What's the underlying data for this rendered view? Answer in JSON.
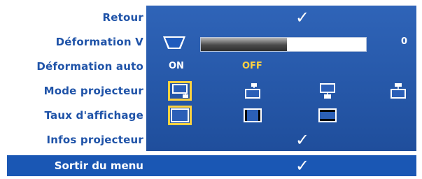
{
  "menu": {
    "rows": [
      {
        "label": "Retour"
      },
      {
        "label": "Déformation V"
      },
      {
        "label": "Déformation auto"
      },
      {
        "label": "Mode projecteur"
      },
      {
        "label": "Taux d'affichage"
      },
      {
        "label": "Infos projecteur"
      }
    ],
    "checkmark": "✓",
    "keystone": {
      "value": "0",
      "fill_percent": 52
    },
    "auto_keystone": {
      "on_label": "ON",
      "off_label": "OFF",
      "selected": "OFF"
    },
    "projector_mode": {
      "options": [
        "front-desktop",
        "front-ceiling",
        "rear-desktop",
        "rear-ceiling"
      ],
      "selected": 0
    },
    "aspect_ratio": {
      "options": [
        "original",
        "4:3",
        "wide"
      ],
      "selected": 0
    },
    "exit": {
      "label": "Sortir du menu"
    },
    "colors": {
      "label_blue": "#1f53a8",
      "panel_blue": "#2f64b8",
      "highlight_yellow": "#ffd23f",
      "exit_blue": "#1a57b4"
    }
  }
}
